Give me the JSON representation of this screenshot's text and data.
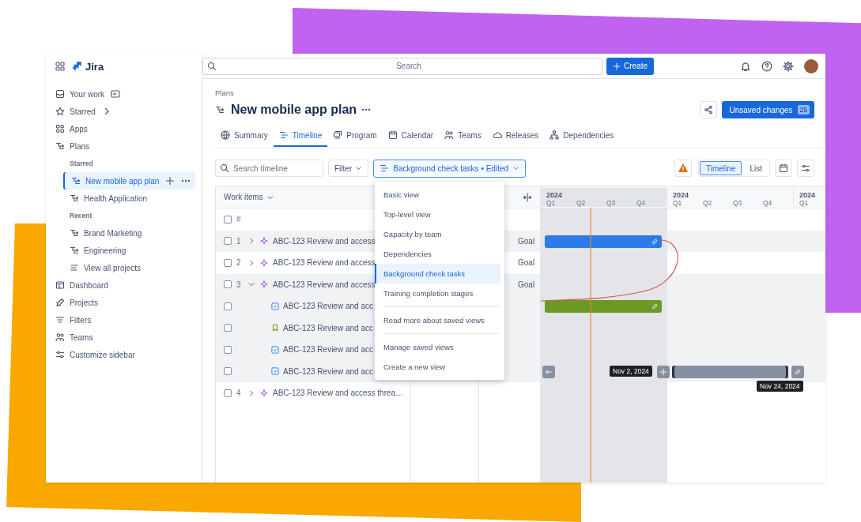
{
  "app": {
    "name": "Jira"
  },
  "sidebar": {
    "items": [
      {
        "kind": "item",
        "label": "Your work",
        "selected": false
      },
      {
        "kind": "item",
        "label": "Starred",
        "selected": false
      },
      {
        "kind": "item",
        "label": "Apps",
        "selected": false
      },
      {
        "kind": "item",
        "label": "Plans",
        "selected": false
      },
      {
        "kind": "section",
        "label": "Starred"
      },
      {
        "kind": "subitem",
        "label": "New mobile app plan",
        "selected": true
      },
      {
        "kind": "subitem",
        "label": "Health Application",
        "selected": false
      },
      {
        "kind": "section",
        "label": "Recent"
      },
      {
        "kind": "subitem",
        "label": "Brand Marketing",
        "selected": false
      },
      {
        "kind": "subitem",
        "label": "Engineering",
        "selected": false
      },
      {
        "kind": "subitem",
        "label": "View all projects",
        "selected": false
      },
      {
        "kind": "item",
        "label": "Dashboard",
        "selected": false
      },
      {
        "kind": "item",
        "label": "Projects",
        "selected": false
      },
      {
        "kind": "item",
        "label": "Filters",
        "selected": false
      },
      {
        "kind": "item",
        "label": "Teams",
        "selected": false
      },
      {
        "kind": "item",
        "label": "Customize sidebar",
        "selected": false
      }
    ]
  },
  "topbar": {
    "search": {
      "placeholder": "Search"
    },
    "create_button": "Create"
  },
  "header": {
    "breadcrumb": "Plans",
    "title": "New mobile app plan",
    "primary_button": {
      "label": "Unsaved changes",
      "count": "25"
    }
  },
  "tabs": [
    {
      "label": "Summary",
      "selected": false
    },
    {
      "label": "Timeline",
      "selected": true
    },
    {
      "label": "Program",
      "selected": false
    },
    {
      "label": "Calendar",
      "selected": false
    },
    {
      "label": "Teams",
      "selected": false
    },
    {
      "label": "Releases",
      "selected": false
    },
    {
      "label": "Dependencies",
      "selected": false
    }
  ],
  "toolbar": {
    "search": {
      "placeholder": "Search timeline"
    },
    "filter": "Filter",
    "view_select": "Background check tasks • Edited",
    "view_toggle": [
      {
        "label": "Timeline",
        "selected": true
      },
      {
        "label": "List",
        "selected": false
      }
    ]
  },
  "view_menu": {
    "groups": [
      {
        "items": [
          {
            "label": "Basic view",
            "selected": false
          },
          {
            "label": "Top-level view",
            "selected": false
          },
          {
            "label": "Capacity by team",
            "selected": false
          },
          {
            "label": "Dependencies",
            "selected": false
          },
          {
            "label": "Background check tasks",
            "selected": true
          },
          {
            "label": "Training completion stages",
            "selected": false
          }
        ]
      },
      {
        "items": [
          {
            "label": "Read more about saved views",
            "selected": false
          }
        ]
      },
      {
        "items": [
          {
            "label": "Manage saved views",
            "selected": false
          },
          {
            "label": "Create a new view",
            "selected": false
          }
        ]
      }
    ]
  },
  "table": {
    "column_header": "Work items",
    "number_header": "#",
    "select_all_checked": false,
    "timeline_years": [
      {
        "year": "2024",
        "quarters": [
          "Q1",
          "Q2",
          "Q3",
          "Q4"
        ]
      },
      {
        "year": "2024",
        "quarters": [
          "Q1",
          "Q2",
          "Q3",
          "Q4"
        ]
      },
      {
        "year": "2024",
        "quarters": [
          "Q1"
        ]
      }
    ],
    "rows": [
      {
        "number": "1",
        "kind": "epic",
        "checked": false,
        "title": "ABC-123 Review and access",
        "expanded": false,
        "goal": "Goal",
        "highlighted": true,
        "bar": {
          "color": "#2d7ae8"
        }
      },
      {
        "number": "2",
        "kind": "epic",
        "checked": false,
        "title": "ABC-123 Review and access",
        "expanded": false,
        "goal": "Goal",
        "highlighted": false
      },
      {
        "number": "3",
        "kind": "epic",
        "checked": false,
        "title": "ABC-123 Review and access",
        "expanded": true,
        "goal": "Goal",
        "highlighted": true,
        "children": [
          {
            "kind": "task",
            "checked": false,
            "title": "ABC-123 Review and acc",
            "highlighted": true,
            "bar": {
              "color": "#6a9a23"
            }
          },
          {
            "kind": "story",
            "checked": false,
            "title": "ABC-123 Review and acc",
            "highlighted": true
          },
          {
            "kind": "task",
            "checked": false,
            "title": "ABC-123 Review and acc",
            "highlighted": true
          },
          {
            "kind": "task",
            "checked": false,
            "title": "ABC-123 Review and acc",
            "highlighted": true,
            "schedule": {
              "start": "Nov 2, 2024",
              "end": "Nov 24, 2024"
            }
          }
        ]
      },
      {
        "number": "4",
        "kind": "epic",
        "checked": false,
        "title": "ABC-123 Review and access threa…",
        "expanded": false,
        "highlighted": false
      }
    ]
  }
}
